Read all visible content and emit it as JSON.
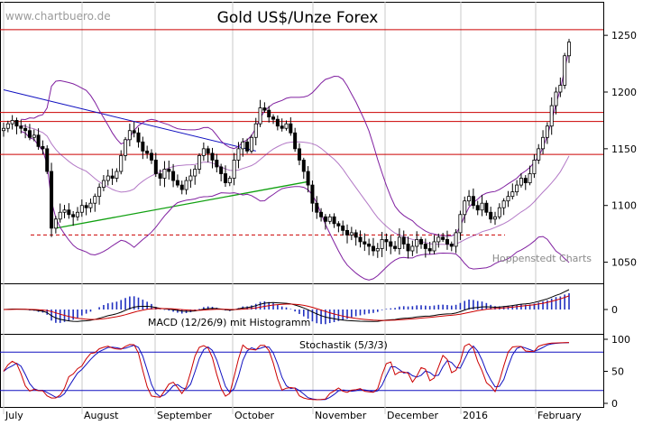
{
  "watermark": "www.chartbuero.de",
  "credit": "Hoppenstedt Charts",
  "colors": {
    "frame": "#000000",
    "grid": "#c8c8c8",
    "resistance": "#cc0000",
    "trend_down": "#1010c0",
    "trend_up": "#10a010",
    "bollinger": "#8020a0",
    "candle": "#000000",
    "macd_line": "#000000",
    "signal_line": "#cc0000",
    "histogram": "#2030c0",
    "stoch_k": "#cc0000",
    "stoch_d": "#1010c0",
    "stoch_levels": "#1010c0"
  },
  "chart_data": [
    {
      "type": "candlestick",
      "title": "Gold US$/Unze Forex",
      "x_labels": [
        "July",
        "August",
        "September",
        "October",
        "November",
        "December",
        "2016",
        "February"
      ],
      "y_ticks": [
        1050,
        1100,
        1150,
        1200,
        1250
      ],
      "ylim": [
        1025,
        1270
      ],
      "horizontal_lines": [
        1255,
        1182,
        1174,
        1145
      ],
      "dashed_support": 1074,
      "trend_down": [
        [
          0,
          1202
        ],
        [
          58,
          1148
        ]
      ],
      "trend_up": [
        [
          12,
          1080
        ],
        [
          70,
          1121
        ]
      ],
      "overlays": [
        "Bollinger upper",
        "Bollinger middle",
        "Bollinger lower"
      ],
      "close": [
        1168,
        1172,
        1175,
        1170,
        1168,
        1166,
        1160,
        1162,
        1152,
        1150,
        1130,
        1080,
        1088,
        1094,
        1096,
        1092,
        1090,
        1094,
        1100,
        1098,
        1102,
        1108,
        1116,
        1122,
        1126,
        1124,
        1130,
        1144,
        1158,
        1166,
        1164,
        1156,
        1148,
        1146,
        1140,
        1128,
        1124,
        1132,
        1130,
        1122,
        1118,
        1114,
        1122,
        1126,
        1132,
        1144,
        1150,
        1146,
        1140,
        1134,
        1128,
        1120,
        1124,
        1140,
        1150,
        1156,
        1148,
        1160,
        1172,
        1186,
        1184,
        1178,
        1176,
        1170,
        1168,
        1172,
        1164,
        1150,
        1140,
        1130,
        1118,
        1102,
        1094,
        1090,
        1086,
        1090,
        1084,
        1082,
        1078,
        1074,
        1076,
        1072,
        1068,
        1066,
        1064,
        1060,
        1062,
        1070,
        1068,
        1064,
        1062,
        1072,
        1066,
        1060,
        1064,
        1070,
        1066,
        1062,
        1060,
        1068,
        1072,
        1070,
        1066,
        1064,
        1076,
        1092,
        1104,
        1108,
        1100,
        1096,
        1102,
        1094,
        1088,
        1090,
        1098,
        1104,
        1108,
        1112,
        1118,
        1124,
        1120,
        1128,
        1140,
        1150,
        1160,
        1170,
        1188,
        1200,
        1206,
        1232,
        1244
      ]
    },
    {
      "type": "line",
      "title": "MACD (12/26/9) mit Histogramm",
      "y_ticks": [
        0
      ],
      "series": [
        {
          "name": "MACD",
          "role": "macd"
        },
        {
          "name": "Signal",
          "role": "signal"
        },
        {
          "name": "Histogramm",
          "role": "histogram"
        }
      ]
    },
    {
      "type": "line",
      "title": "Stochastik (5/3/3)",
      "y_ticks": [
        0,
        50,
        100
      ],
      "ylim": [
        0,
        100
      ],
      "levels": [
        80,
        20
      ],
      "series": [
        {
          "name": "%K",
          "role": "k"
        },
        {
          "name": "%D",
          "role": "d"
        }
      ]
    }
  ]
}
